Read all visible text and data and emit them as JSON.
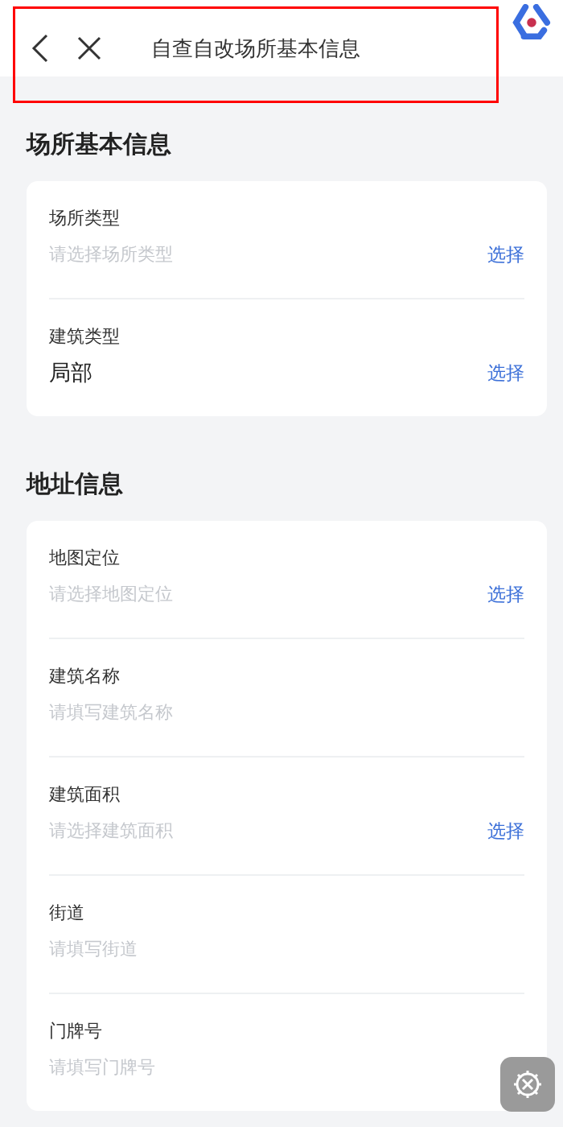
{
  "header": {
    "title": "自查自改场所基本信息",
    "highlighted": true
  },
  "sections": [
    {
      "title": "场所基本信息",
      "fields": [
        {
          "label": "场所类型",
          "placeholder": "请选择场所类型",
          "action": "选择"
        },
        {
          "label": "建筑类型",
          "value": "局部",
          "action": "选择"
        }
      ]
    },
    {
      "title": "地址信息",
      "fields": [
        {
          "label": "地图定位",
          "placeholder": "请选择地图定位",
          "action": "选择"
        },
        {
          "label": "建筑名称",
          "placeholder": "请填写建筑名称"
        },
        {
          "label": "建筑面积",
          "placeholder": "请选择建筑面积",
          "action": "选择"
        },
        {
          "label": "街道",
          "placeholder": "请填写街道"
        },
        {
          "label": "门牌号",
          "placeholder": "请填写门牌号"
        }
      ]
    }
  ]
}
